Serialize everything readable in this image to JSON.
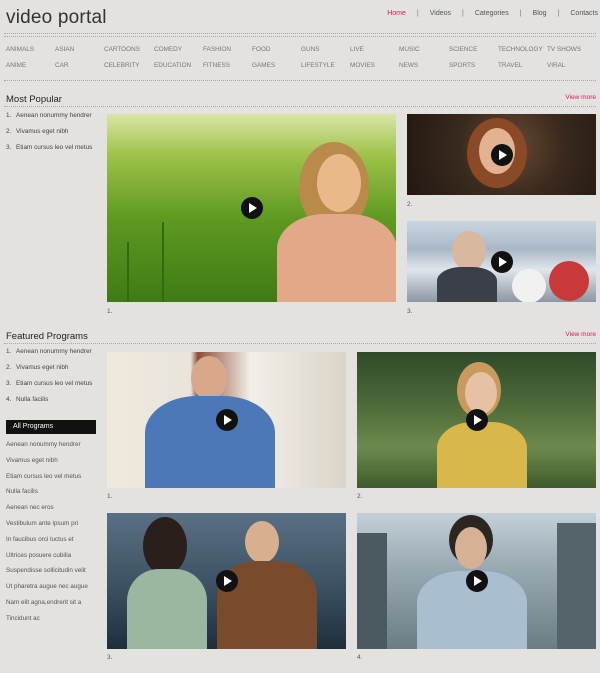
{
  "header": {
    "logo": "video portal",
    "nav": [
      {
        "label": "Home",
        "active": true
      },
      {
        "label": "Videos",
        "active": false
      },
      {
        "label": "Categories",
        "active": false
      },
      {
        "label": "Blog",
        "active": false
      },
      {
        "label": "Contacts",
        "active": false
      }
    ]
  },
  "categories": {
    "row1": [
      "ANIMALS",
      "ASIAN",
      "CARTOONS",
      "COMEDY",
      "FASHION",
      "FOOD",
      "GUNS",
      "LIVE",
      "MUSIC",
      "SCIENCE",
      "TECHNOLOGY",
      "TV SHOWS"
    ],
    "row2": [
      "ANIME",
      "CAR",
      "CELEBRITY",
      "EDUCATION",
      "FITNESS",
      "GAMES",
      "LIFESTYLE",
      "MOVIES",
      "NEWS",
      "SPORTS",
      "TRAVEL",
      "VIRAL"
    ]
  },
  "most_popular": {
    "title": "Most Popular",
    "view_more": "View more",
    "items": [
      {
        "num": "1.",
        "label": "Aenean nonummy hendrer"
      },
      {
        "num": "2.",
        "label": "Vivamus eget nibh"
      },
      {
        "num": "3.",
        "label": "Etiam cursus leo vel metus"
      }
    ],
    "captions": [
      "1.",
      "2.",
      "3."
    ]
  },
  "featured": {
    "title": "Featured Programs",
    "view_more": "View more",
    "items": [
      {
        "num": "1.",
        "label": "Aenean nonummy hendrer"
      },
      {
        "num": "2.",
        "label": "Vivamus eget nibh"
      },
      {
        "num": "3.",
        "label": "Etiam cursus leo vel metus"
      },
      {
        "num": "4.",
        "label": "Nulla facilis"
      }
    ],
    "captions": [
      "1.",
      "2.",
      "3.",
      "4."
    ]
  },
  "all_programs": {
    "title": "All Programs",
    "items": [
      "Aenean nonummy hendrer",
      "Vivamus eget nibh",
      "Etiam cursus leo vel metus",
      "Nulla facilis",
      "Aenean nec eros",
      "Vestibulum ante ipsum pri",
      "In faucibus orci luctus et",
      "Ultrices posuere cubilia",
      "Suspendisse sollicitudin velit",
      "Ut pharetra augue nec augue",
      "Nam elit agna,endrerit sit a",
      "Tincidunt ac"
    ]
  },
  "colors": {
    "accent": "#d41a62",
    "background": "#e3e2df"
  }
}
